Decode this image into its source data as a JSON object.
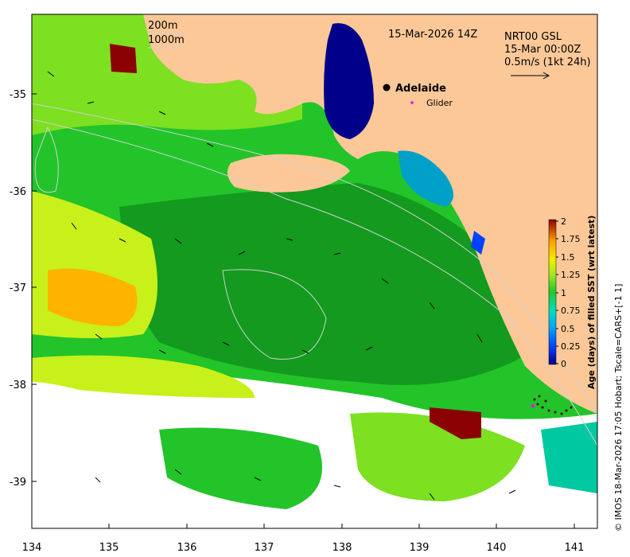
{
  "map": {
    "type": "heatmap",
    "timestamp_title": "15-Mar-2026 14Z",
    "contours": [
      "200m",
      "1000m"
    ],
    "current_info": {
      "line1": "NRT00 GSL",
      "line2": "15-Mar 00:00Z",
      "line3": "0.5m/s (1kt 24h)"
    },
    "city_label": "Adelaide",
    "glider_label": "Glider",
    "credit": "© IMOS 18-Mar-2026 17:05 Hobart; Tscale=CARS+[-1 1]",
    "colors": {
      "land": "#fcc898",
      "gulf": "#00008b",
      "green": "#22c42a",
      "dark_green": "#149a1e",
      "light_green": "#7de020",
      "yellow_green": "#c8f01a",
      "orange": "#ffb400",
      "dark_red": "#8b0000",
      "cyan": "#20c8e0",
      "teal": "#00c8a0"
    }
  },
  "chart_data": {
    "type": "heatmap",
    "xlabel": "",
    "ylabel": "",
    "xlim": [
      134,
      141.3
    ],
    "ylim": [
      -39.5,
      -34.2
    ],
    "x_ticks": [
      "134",
      "135",
      "136",
      "137",
      "138",
      "139",
      "140",
      "141"
    ],
    "y_ticks": [
      "-35",
      "-36",
      "-37",
      "-38",
      "-39"
    ],
    "colorbar": {
      "title": "Age (days) of filled SST (wrt latest)",
      "range": [
        0,
        2
      ],
      "ticks": [
        "0",
        "0.25",
        "0.5",
        "0.75",
        "1",
        "1.25",
        "1.5",
        "1.75",
        "2"
      ]
    }
  }
}
